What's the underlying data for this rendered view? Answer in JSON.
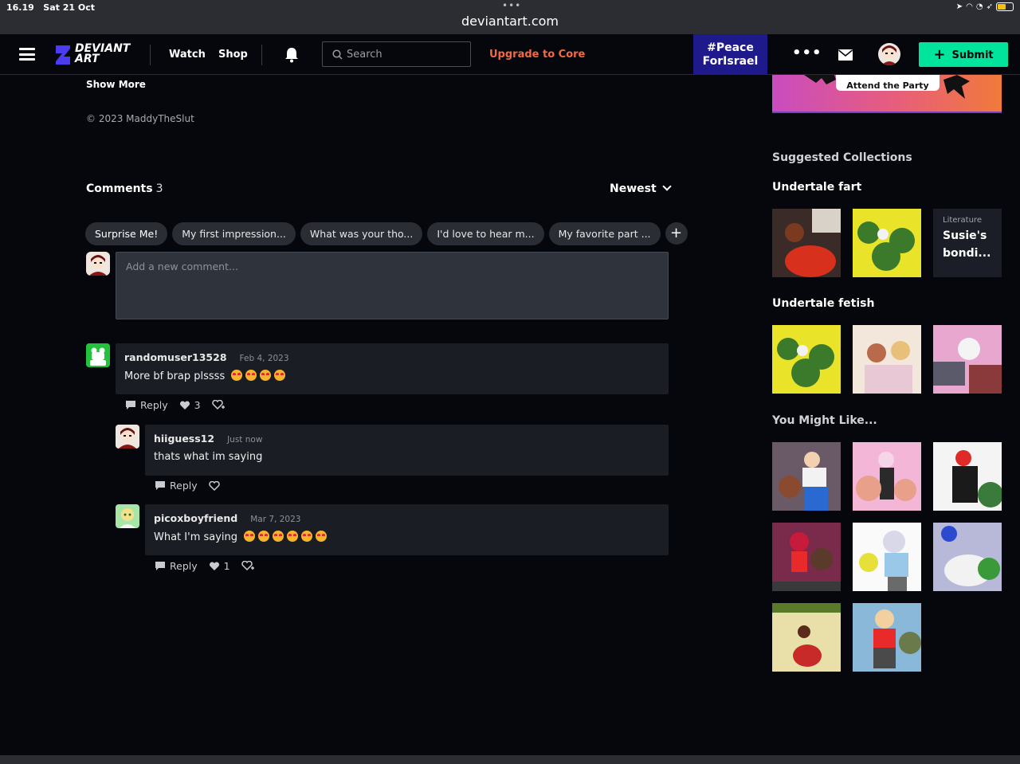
{
  "status_bar": {
    "time": "16.19",
    "date": "Sat 21 Oct",
    "url": "deviantart.com"
  },
  "nav": {
    "logo_line1": "DEVIANT",
    "logo_line2": "ART",
    "watch": "Watch",
    "shop": "Shop",
    "search_placeholder": "Search",
    "upgrade": "Upgrade to Core",
    "peace_line1": "#Peace",
    "peace_line2": "ForIsrael",
    "more": "•••",
    "submit": "Submit",
    "colors": {
      "accent": "#00e59b",
      "upgrade": "#f26a44",
      "peace_bg": "#1f1a8c"
    }
  },
  "main": {
    "show_more": "Show More",
    "copyright": "© 2023 MaddyTheSlut",
    "comments_label": "Comments",
    "comments_count": "3",
    "sort": "Newest",
    "chips": [
      "Surprise Me!",
      "My first impression...",
      "What was your tho...",
      "I'd love to hear m...",
      "My favorite part ..."
    ],
    "chip_add": "+",
    "comment_placeholder": "Add a new comment..."
  },
  "comments": [
    {
      "user": "randomuser13528",
      "date": "Feb 4, 2023",
      "text": "More bf brap plssss",
      "emojis": 4,
      "reply": "Reply",
      "likes": "3"
    },
    {
      "user": "hiiguess12",
      "date": "Just now",
      "text": "thats what im saying",
      "emojis": 0,
      "reply": "Reply",
      "likes": ""
    },
    {
      "user": "picoxboyfriend",
      "date": "Mar 7, 2023",
      "text": "What I'm saying",
      "emojis": 6,
      "reply": "Reply",
      "likes": "1"
    }
  ],
  "sidebar": {
    "banner_text": "Attend the Party",
    "suggested_title": "Suggested Collections",
    "collection1": "Undertale fart",
    "literature_kind": "Literature",
    "literature_title_1": "Susie's",
    "literature_title_2": "bondi...",
    "collection2": "Undertale fetish",
    "you_might_like": "You Might Like..."
  }
}
